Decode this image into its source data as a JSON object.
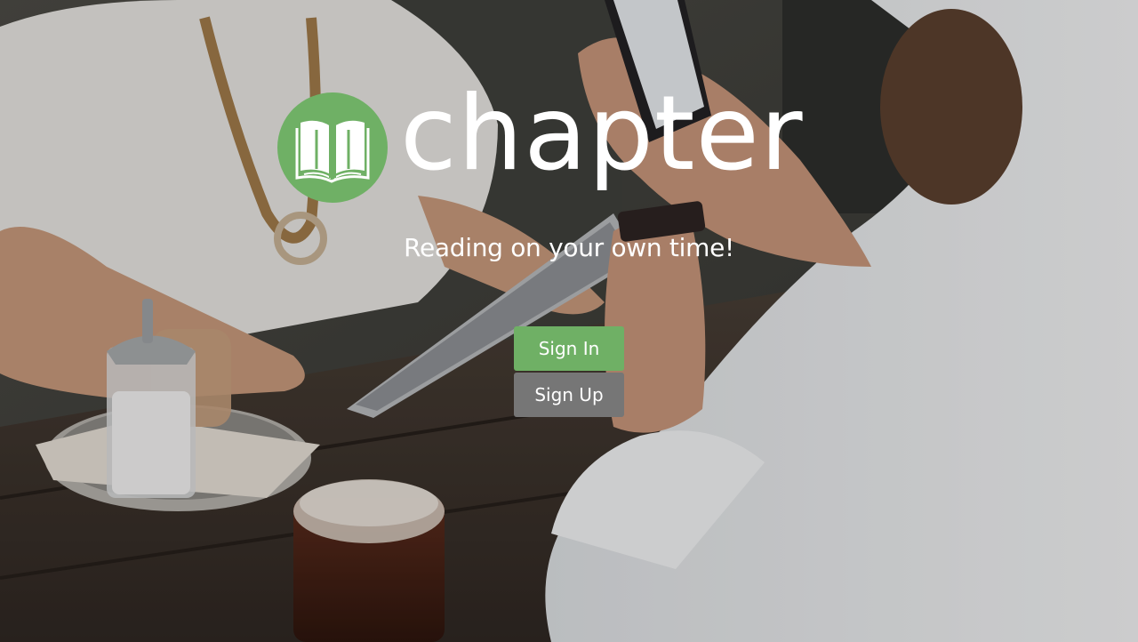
{
  "brand": {
    "name": "chapter",
    "logo_icon": "open-book-icon",
    "accent_color": "#6fb065"
  },
  "hero": {
    "tagline": "Reading on your own time!"
  },
  "actions": {
    "sign_in_label": "Sign In",
    "sign_in_color": "#6fb065",
    "sign_up_label": "Sign Up",
    "sign_up_color": "#767676"
  },
  "background": {
    "description_icon": "cafe-photo"
  }
}
